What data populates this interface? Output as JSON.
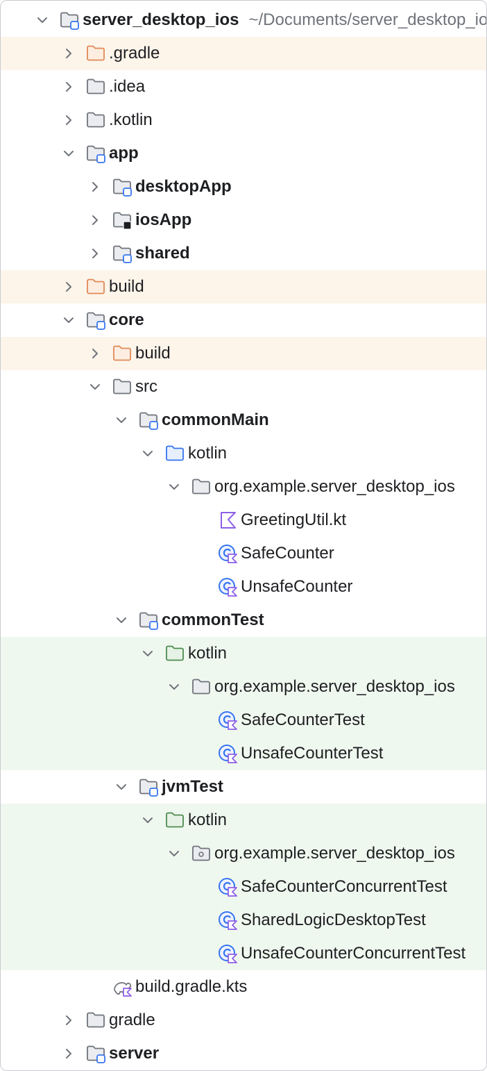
{
  "colors": {
    "folder_gray": "#6f737a",
    "folder_fill": "#ebecf0",
    "excluded_orange": "#e08855",
    "excluded_fill": "#fdeee1",
    "source_blue": "#3574f0",
    "source_fill": "#e7effd",
    "test_green": "#4d8a4f",
    "test_fill": "#e6f2e6",
    "kotlin_purple": "#8c5fe8",
    "build_highlight": "#fdf5ea",
    "test_highlight": "#eff8ef"
  },
  "tree": [
    {
      "label": "server_desktop_ios",
      "path": "~/Documents/server_desktop_ios",
      "depth": 0,
      "icon": "module-folder-icon",
      "expand": "open",
      "bold": true
    },
    {
      "label": ".gradle",
      "depth": 1,
      "icon": "excluded-folder-icon",
      "expand": "closed",
      "highlight": "build"
    },
    {
      "label": ".idea",
      "depth": 1,
      "icon": "folder-icon",
      "expand": "closed"
    },
    {
      "label": ".kotlin",
      "depth": 1,
      "icon": "folder-icon",
      "expand": "closed"
    },
    {
      "label": "app",
      "depth": 1,
      "icon": "module-folder-icon",
      "expand": "open",
      "bold": true
    },
    {
      "label": "desktopApp",
      "depth": 2,
      "icon": "module-folder-icon",
      "expand": "closed",
      "bold": true
    },
    {
      "label": "iosApp",
      "depth": 2,
      "icon": "ios-module-folder-icon",
      "expand": "closed",
      "bold": true
    },
    {
      "label": "shared",
      "depth": 2,
      "icon": "module-folder-icon",
      "expand": "closed",
      "bold": true
    },
    {
      "label": "build",
      "depth": 1,
      "icon": "excluded-folder-icon",
      "expand": "closed",
      "highlight": "build"
    },
    {
      "label": "core",
      "depth": 1,
      "icon": "module-folder-icon",
      "expand": "open",
      "bold": true
    },
    {
      "label": "build",
      "depth": 2,
      "icon": "excluded-folder-icon",
      "expand": "closed",
      "highlight": "build"
    },
    {
      "label": "src",
      "depth": 2,
      "icon": "folder-icon",
      "expand": "open"
    },
    {
      "label": "commonMain",
      "depth": 3,
      "icon": "module-folder-icon",
      "expand": "open",
      "bold": true
    },
    {
      "label": "kotlin",
      "depth": 4,
      "icon": "source-root-folder-icon",
      "expand": "open"
    },
    {
      "label": "org.example.server_desktop_ios",
      "depth": 5,
      "icon": "package-folder-icon",
      "expand": "open"
    },
    {
      "label": "GreetingUtil.kt",
      "depth": 6,
      "icon": "kotlin-file-icon",
      "expand": "none"
    },
    {
      "label": "SafeCounter",
      "depth": 6,
      "icon": "kotlin-class-icon",
      "expand": "none"
    },
    {
      "label": "UnsafeCounter",
      "depth": 6,
      "icon": "kotlin-class-icon",
      "expand": "none"
    },
    {
      "label": "commonTest",
      "depth": 3,
      "icon": "module-folder-icon",
      "expand": "open",
      "bold": true
    },
    {
      "label": "kotlin",
      "depth": 4,
      "icon": "test-root-folder-icon",
      "expand": "open",
      "highlight": "test"
    },
    {
      "label": "org.example.server_desktop_ios",
      "depth": 5,
      "icon": "package-folder-icon",
      "expand": "open",
      "highlight": "test"
    },
    {
      "label": "SafeCounterTest",
      "depth": 6,
      "icon": "kotlin-class-icon",
      "expand": "none",
      "highlight": "test"
    },
    {
      "label": "UnsafeCounterTest",
      "depth": 6,
      "icon": "kotlin-class-icon",
      "expand": "none",
      "highlight": "test"
    },
    {
      "label": "jvmTest",
      "depth": 3,
      "icon": "module-folder-icon",
      "expand": "open",
      "bold": true
    },
    {
      "label": "kotlin",
      "depth": 4,
      "icon": "test-root-folder-icon",
      "expand": "open",
      "highlight": "test"
    },
    {
      "label": "org.example.server_desktop_ios",
      "depth": 5,
      "icon": "package-dot-folder-icon",
      "expand": "open",
      "highlight": "test"
    },
    {
      "label": "SafeCounterConcurrentTest",
      "depth": 6,
      "icon": "kotlin-class-icon",
      "expand": "none",
      "highlight": "test"
    },
    {
      "label": "SharedLogicDesktopTest",
      "depth": 6,
      "icon": "kotlin-class-icon",
      "expand": "none",
      "highlight": "test"
    },
    {
      "label": "UnsafeCounterConcurrentTest",
      "depth": 6,
      "icon": "kotlin-class-icon",
      "expand": "none",
      "highlight": "test"
    },
    {
      "label": "build.gradle.kts",
      "depth": 2,
      "icon": "gradle-kotlin-file-icon",
      "expand": "none"
    },
    {
      "label": "gradle",
      "depth": 1,
      "icon": "folder-icon",
      "expand": "closed"
    },
    {
      "label": "server",
      "depth": 1,
      "icon": "module-folder-icon",
      "expand": "closed",
      "bold": true
    }
  ]
}
